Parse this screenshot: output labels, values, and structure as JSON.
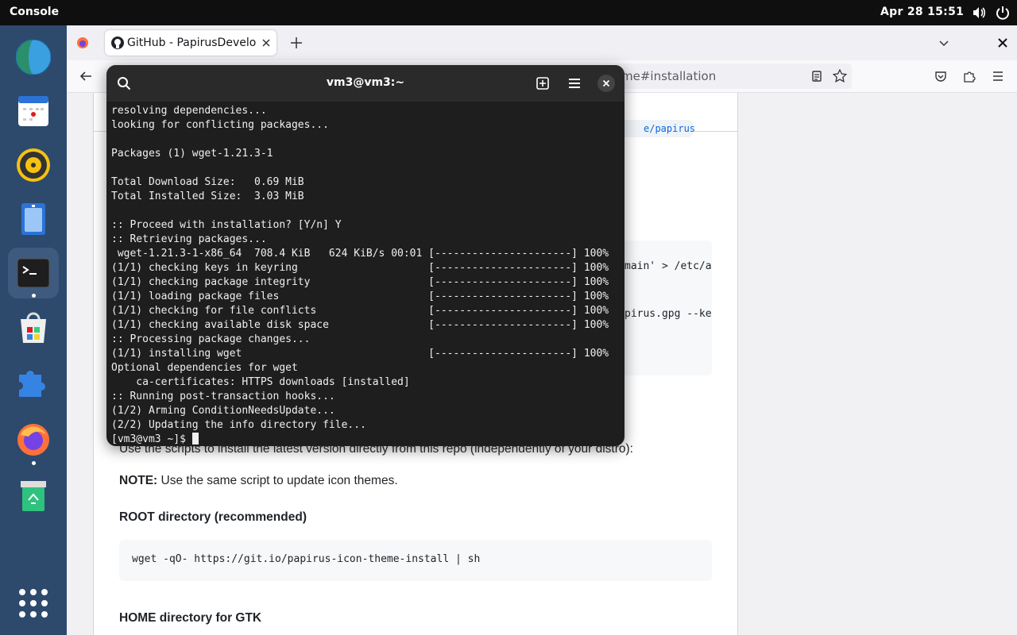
{
  "topbar": {
    "activities": "Console",
    "clock": "Apr 28  15:51"
  },
  "dock": {
    "items": [
      {
        "name": "globe-app"
      },
      {
        "name": "calendar-app"
      },
      {
        "name": "rhythmbox-app"
      },
      {
        "name": "files-app"
      },
      {
        "name": "console-app",
        "running": true
      },
      {
        "name": "software-app"
      },
      {
        "name": "extensions-app"
      },
      {
        "name": "firefox-app",
        "running": true
      },
      {
        "name": "trash-app"
      },
      {
        "name": "show-apps"
      }
    ]
  },
  "browser": {
    "tab_title": "GitHub - PapirusDevelopmentTeam",
    "url_visible": "me#installation",
    "page": {
      "partial_cmd_1": "e/papirus",
      "partial_cmd_2": "main' > /etc/a",
      "partial_cmd_3": "pirus.gpg --ke",
      "intro": "Use the scripts to install the latest version directly from this repo (independently of your distro):",
      "note_label": "NOTE:",
      "note_text": " Use the same script to update icon themes.",
      "root_heading": "ROOT directory (recommended)",
      "root_cmd": "wget -qO- https://git.io/papirus-icon-theme-install | sh",
      "home_heading": "HOME directory for GTK"
    }
  },
  "terminal": {
    "title": "vm3@vm3:~",
    "lines": [
      "resolving dependencies...",
      "looking for conflicting packages...",
      "",
      "Packages (1) wget-1.21.3-1",
      "",
      "Total Download Size:   0.69 MiB",
      "Total Installed Size:  3.03 MiB",
      "",
      ":: Proceed with installation? [Y/n] Y",
      ":: Retrieving packages...",
      " wget-1.21.3-1-x86_64  708.4 KiB   624 KiB/s 00:01 [----------------------] 100%",
      "(1/1) checking keys in keyring                     [----------------------] 100%",
      "(1/1) checking package integrity                   [----------------------] 100%",
      "(1/1) loading package files                        [----------------------] 100%",
      "(1/1) checking for file conflicts                  [----------------------] 100%",
      "(1/1) checking available disk space                [----------------------] 100%",
      ":: Processing package changes...",
      "(1/1) installing wget                              [----------------------] 100%",
      "Optional dependencies for wget",
      "    ca-certificates: HTTPS downloads [installed]",
      ":: Running post-transaction hooks...",
      "(1/2) Arming ConditionNeedsUpdate...",
      "(2/2) Updating the info directory file..."
    ],
    "prompt": "[vm3@vm3 ~]$ "
  }
}
